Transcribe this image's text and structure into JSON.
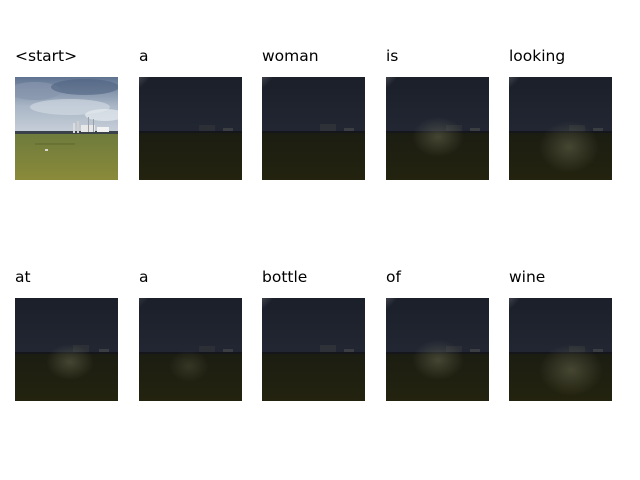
{
  "caption_words": [
    "<start>",
    "a",
    "woman",
    "is",
    "looking",
    "at",
    "a",
    "bottle",
    "of",
    "wine"
  ],
  "attention_maps": [
    {
      "word_index": 0,
      "kind": "original-image",
      "description": "field under cloudy sky with harbor structures"
    },
    {
      "word_index": 1,
      "kind": "attention-overlay",
      "focus": "top-left corner"
    },
    {
      "word_index": 2,
      "kind": "attention-overlay",
      "focus": "top-left corner"
    },
    {
      "word_index": 3,
      "kind": "attention-overlay",
      "focus": "top-left corner and lower center"
    },
    {
      "word_index": 4,
      "kind": "attention-overlay",
      "focus": "top-left corner and lower center/right"
    },
    {
      "word_index": 5,
      "kind": "attention-overlay",
      "focus": "lower center"
    },
    {
      "word_index": 6,
      "kind": "attention-overlay",
      "focus": "top-left corner"
    },
    {
      "word_index": 7,
      "kind": "attention-overlay",
      "focus": "top-left corner"
    },
    {
      "word_index": 8,
      "kind": "attention-overlay",
      "focus": "top-left corner and lower center"
    },
    {
      "word_index": 9,
      "kind": "attention-overlay",
      "focus": "top-left corner and lower center/right"
    }
  ]
}
